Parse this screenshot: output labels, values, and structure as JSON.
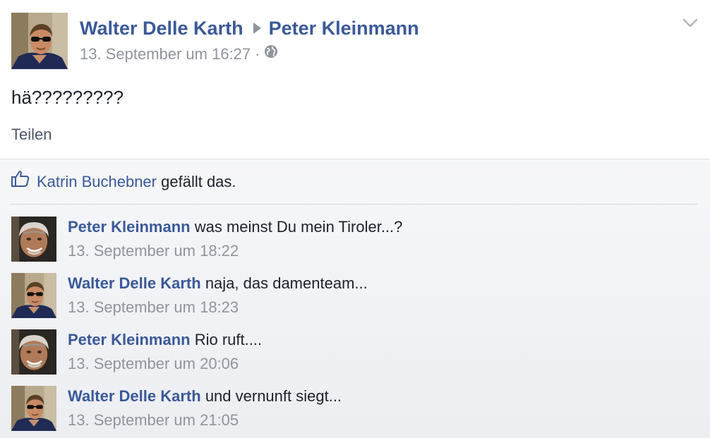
{
  "post": {
    "author": "Walter Delle Karth",
    "recipient": "Peter Kleinmann",
    "timestamp": "13. September um 16:27",
    "separator": "·",
    "privacy_icon": "globe-icon",
    "text": "hä?????????",
    "share_label": "Teilen",
    "menu_icon": "chevron-down-icon"
  },
  "likes": {
    "icon": "thumbs-up-icon",
    "liker": "Katrin Buchebner",
    "suffix": "gefällt das."
  },
  "comments": [
    {
      "author": "Peter Kleinmann",
      "text": "was meinst Du mein Tiroler...?",
      "time": "13. September um 18:22"
    },
    {
      "author": "Walter Delle Karth",
      "text": "naja, das damenteam...",
      "time": "13. September um 18:23"
    },
    {
      "author": "Peter Kleinmann",
      "text": "Rio ruft....",
      "time": "13. September um 20:06"
    },
    {
      "author": "Walter Delle Karth",
      "text": "und vernunft siegt...",
      "time": "13. September um 21:05"
    }
  ],
  "colors": {
    "link": "#3b5998",
    "meta_grey": "#90949c",
    "feedback_bg": "#f6f7f9",
    "divider": "#dddfe2"
  }
}
